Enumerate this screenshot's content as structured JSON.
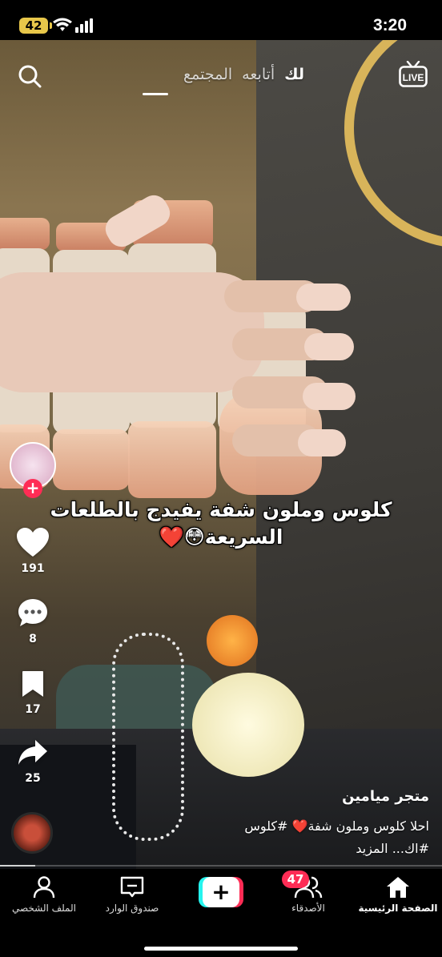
{
  "status_bar": {
    "battery": "42",
    "time": "3:20"
  },
  "top_nav": {
    "tabs": [
      {
        "label": "لك",
        "active": true
      },
      {
        "label": "أتابعه",
        "active": false
      },
      {
        "label": "المجتمع",
        "active": false
      }
    ],
    "search_icon": "search-icon",
    "live_label": "LIVE"
  },
  "video": {
    "caption_line1": "كلوس وملون شفة يفيدج بالطلعات",
    "caption_line2": "السريعة😳❤️",
    "progress_fraction": 0.08
  },
  "actions": {
    "likes": "191",
    "comments": "8",
    "saves": "17",
    "shares": "25"
  },
  "creator": {
    "name": "متجر ميامين"
  },
  "description": {
    "line1": "احلا كلوس وملون شفة❤️ #كلوس",
    "line2": "#اك... المزيد"
  },
  "bottom_nav": {
    "home": "الصفحة الرئيسية",
    "friends": "الأصدقاء",
    "friends_badge": "47",
    "create": "+",
    "inbox": "صندوق الوارد",
    "profile": "الملف الشخصي"
  },
  "colors": {
    "accent_pink": "#fe2c55",
    "accent_cyan": "#25f4ee",
    "battery": "#e8c74a"
  }
}
